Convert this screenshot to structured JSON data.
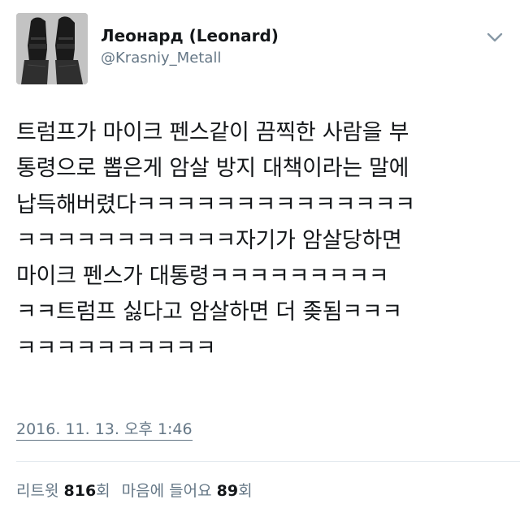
{
  "profile": {
    "display_name": "Леонард (Leonard)",
    "handle": "@Krasniy_Metall",
    "avatar_icon": "boots-photo-avatar"
  },
  "menu": {
    "icon": "chevron-down-icon"
  },
  "tweet": {
    "lines": [
      "트럼프가 마이크 펜스같이 끔찍한 사람을 부",
      "통령으로 뽑은게 암살 방지 대책이라는 말에",
      "납득해버렸다ㅋㅋㅋㅋㅋㅋㅋㅋㅋㅋㅋㅋㅋㅋ",
      "ㅋㅋㅋㅋㅋㅋㅋㅋㅋㅋㅋ자기가 암살당하면",
      "마이크 펜스가 대통령ㅋㅋㅋㅋㅋㅋㅋㅋㅋ",
      "ㅋㅋ트럼프 싫다고 암살하면 더 좆됨ㅋㅋㅋ",
      "ㅋㅋㅋㅋㅋㅋㅋㅋㅋㅋ"
    ],
    "timestamp": "2016. 11. 13. 오후 1:46"
  },
  "stats": {
    "retweet_label": "리트윗",
    "retweet_count": "816",
    "retweet_unit": "회",
    "like_label": "마음에 들어요",
    "like_count": "89",
    "like_unit": "회"
  },
  "colors": {
    "text": "#14171a",
    "secondary": "#657786",
    "divider": "#e1e8ed"
  }
}
